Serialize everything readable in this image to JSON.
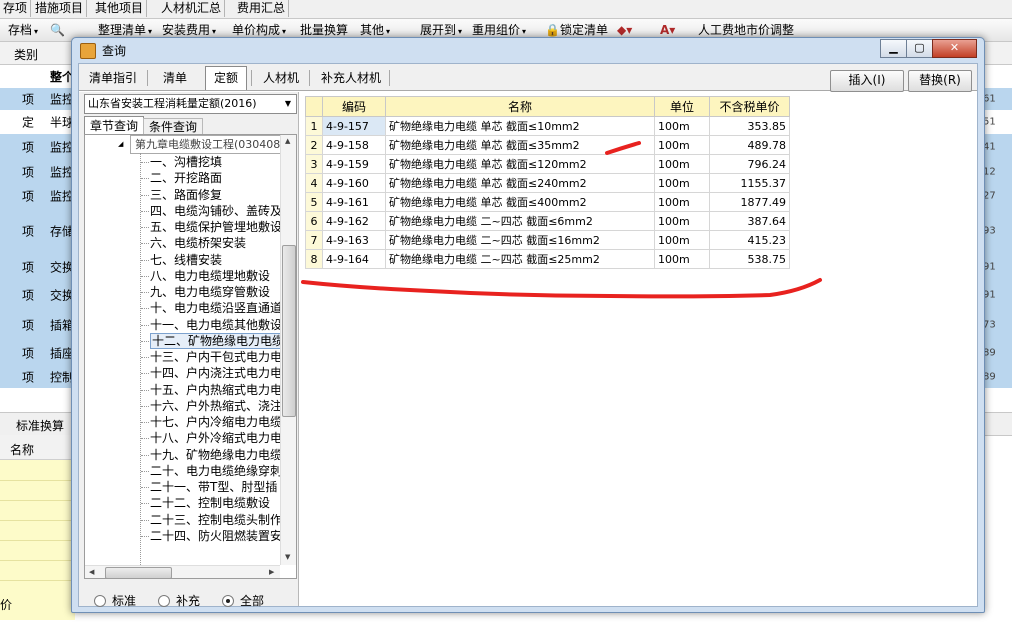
{
  "background": {
    "tabs": [
      "存项",
      "措施项目",
      "其他项目",
      "人材机汇总",
      "费用汇总"
    ],
    "toolbar": [
      {
        "label": "存档",
        "dd": true
      },
      {
        "label": "整理清单",
        "dd": true
      },
      {
        "label": "安装费用",
        "dd": true
      },
      {
        "label": "单价构成",
        "dd": true
      },
      {
        "label": "批量换算",
        "dd": false
      },
      {
        "label": "其他",
        "dd": true
      },
      {
        "label": "展开到",
        "dd": true
      },
      {
        "label": "重用组价",
        "dd": true
      },
      {
        "label": "锁定清单",
        "dd": false
      },
      {
        "label": "人工费地市价调整",
        "dd": false
      }
    ],
    "header_col": "类别",
    "header_col2": "整个",
    "rows": [
      {
        "type": "项",
        "name": "监控",
        "end": "61"
      },
      {
        "type": "定",
        "name": "半球",
        "end": "51"
      },
      {
        "type": "项",
        "name": "监控",
        "end": "41"
      },
      {
        "type": "项",
        "name": "监控",
        "end": "12"
      },
      {
        "type": "项",
        "name": "监控",
        "end": "27"
      },
      {
        "type": "项",
        "name": "存储",
        "end": "93"
      },
      {
        "type": "项",
        "name": "交换",
        "end": "91"
      },
      {
        "type": "项",
        "name": "交换",
        "end": "91"
      },
      {
        "type": "项",
        "name": "插箱",
        "end": "73"
      },
      {
        "type": "项",
        "name": "插座",
        "end": "89"
      },
      {
        "type": "项",
        "name": "控制",
        "end": "89"
      }
    ],
    "lower_tab": "标准换算",
    "lower_header": "名称",
    "lower_footer": "价"
  },
  "dialog": {
    "title": "查询",
    "tabs": [
      "清单指引",
      "清单",
      "定额",
      "人材机",
      "补充人材机"
    ],
    "active_tab": "定额",
    "insert_button": "插入(I)",
    "replace_button": "替换(R)",
    "quota_library": "山东省安装工程消耗量定额(2016)",
    "left_tabs": [
      "章节查询",
      "条件查询"
    ],
    "tree_root": "第九章电缆敷设工程(030408)",
    "tree_items": [
      "一、沟槽挖填",
      "二、开挖路面",
      "三、路面修复",
      "四、电缆沟铺砂、盖砖及",
      "五、电缆保护管埋地敷设",
      "六、电缆桥架安装",
      "七、线槽安装",
      "八、电力电缆埋地敷设",
      "九、电力电缆穿管敷设",
      "十、电力电缆沿竖直通道",
      "十一、电力电缆其他敷设",
      "十二、矿物绝缘电力电缆",
      "十三、户内干包式电力电",
      "十四、户内浇注式电力电",
      "十五、户内热缩式电力电",
      "十六、户外热缩式、浇注",
      "十七、户内冷缩电力电缆",
      "十八、户外冷缩式电力电",
      "十九、矿物绝缘电力电缆",
      "二十、电力电缆绝缘穿刺",
      "二十一、带T型、肘型插",
      "二十二、控制电缆敷设",
      "二十三、控制电缆头制作",
      "二十四、防火阻燃装置安"
    ],
    "selected_tree_index": 11,
    "radios": [
      {
        "label": "标准",
        "checked": false
      },
      {
        "label": "补充",
        "checked": false
      },
      {
        "label": "全部",
        "checked": true
      }
    ],
    "table": {
      "columns": [
        "编码",
        "名称",
        "单位",
        "不含税单价"
      ],
      "rows": [
        {
          "no": "1",
          "code": "4-9-157",
          "name": "矿物绝缘电力电缆 单芯 截面≤10mm2",
          "unit": "100m",
          "price": "353.85"
        },
        {
          "no": "2",
          "code": "4-9-158",
          "name": "矿物绝缘电力电缆 单芯 截面≤35mm2",
          "unit": "100m",
          "price": "489.78"
        },
        {
          "no": "3",
          "code": "4-9-159",
          "name": "矿物绝缘电力电缆 单芯 截面≤120mm2",
          "unit": "100m",
          "price": "796.24"
        },
        {
          "no": "4",
          "code": "4-9-160",
          "name": "矿物绝缘电力电缆 单芯 截面≤240mm2",
          "unit": "100m",
          "price": "1155.37"
        },
        {
          "no": "5",
          "code": "4-9-161",
          "name": "矿物绝缘电力电缆 单芯 截面≤400mm2",
          "unit": "100m",
          "price": "1877.49"
        },
        {
          "no": "6",
          "code": "4-9-162",
          "name": "矿物绝缘电力电缆 二~四芯 截面≤6mm2",
          "unit": "100m",
          "price": "387.64"
        },
        {
          "no": "7",
          "code": "4-9-163",
          "name": "矿物绝缘电力电缆 二~四芯 截面≤16mm2",
          "unit": "100m",
          "price": "415.23"
        },
        {
          "no": "8",
          "code": "4-9-164",
          "name": "矿物绝缘电力电缆 二~四芯 截面≤25mm2",
          "unit": "100m",
          "price": "538.75"
        }
      ]
    }
  },
  "colors": {
    "row_highlight": "#bad6ee",
    "header_yellow": "#fdf5bf",
    "annotation_red": "#e8221f"
  }
}
